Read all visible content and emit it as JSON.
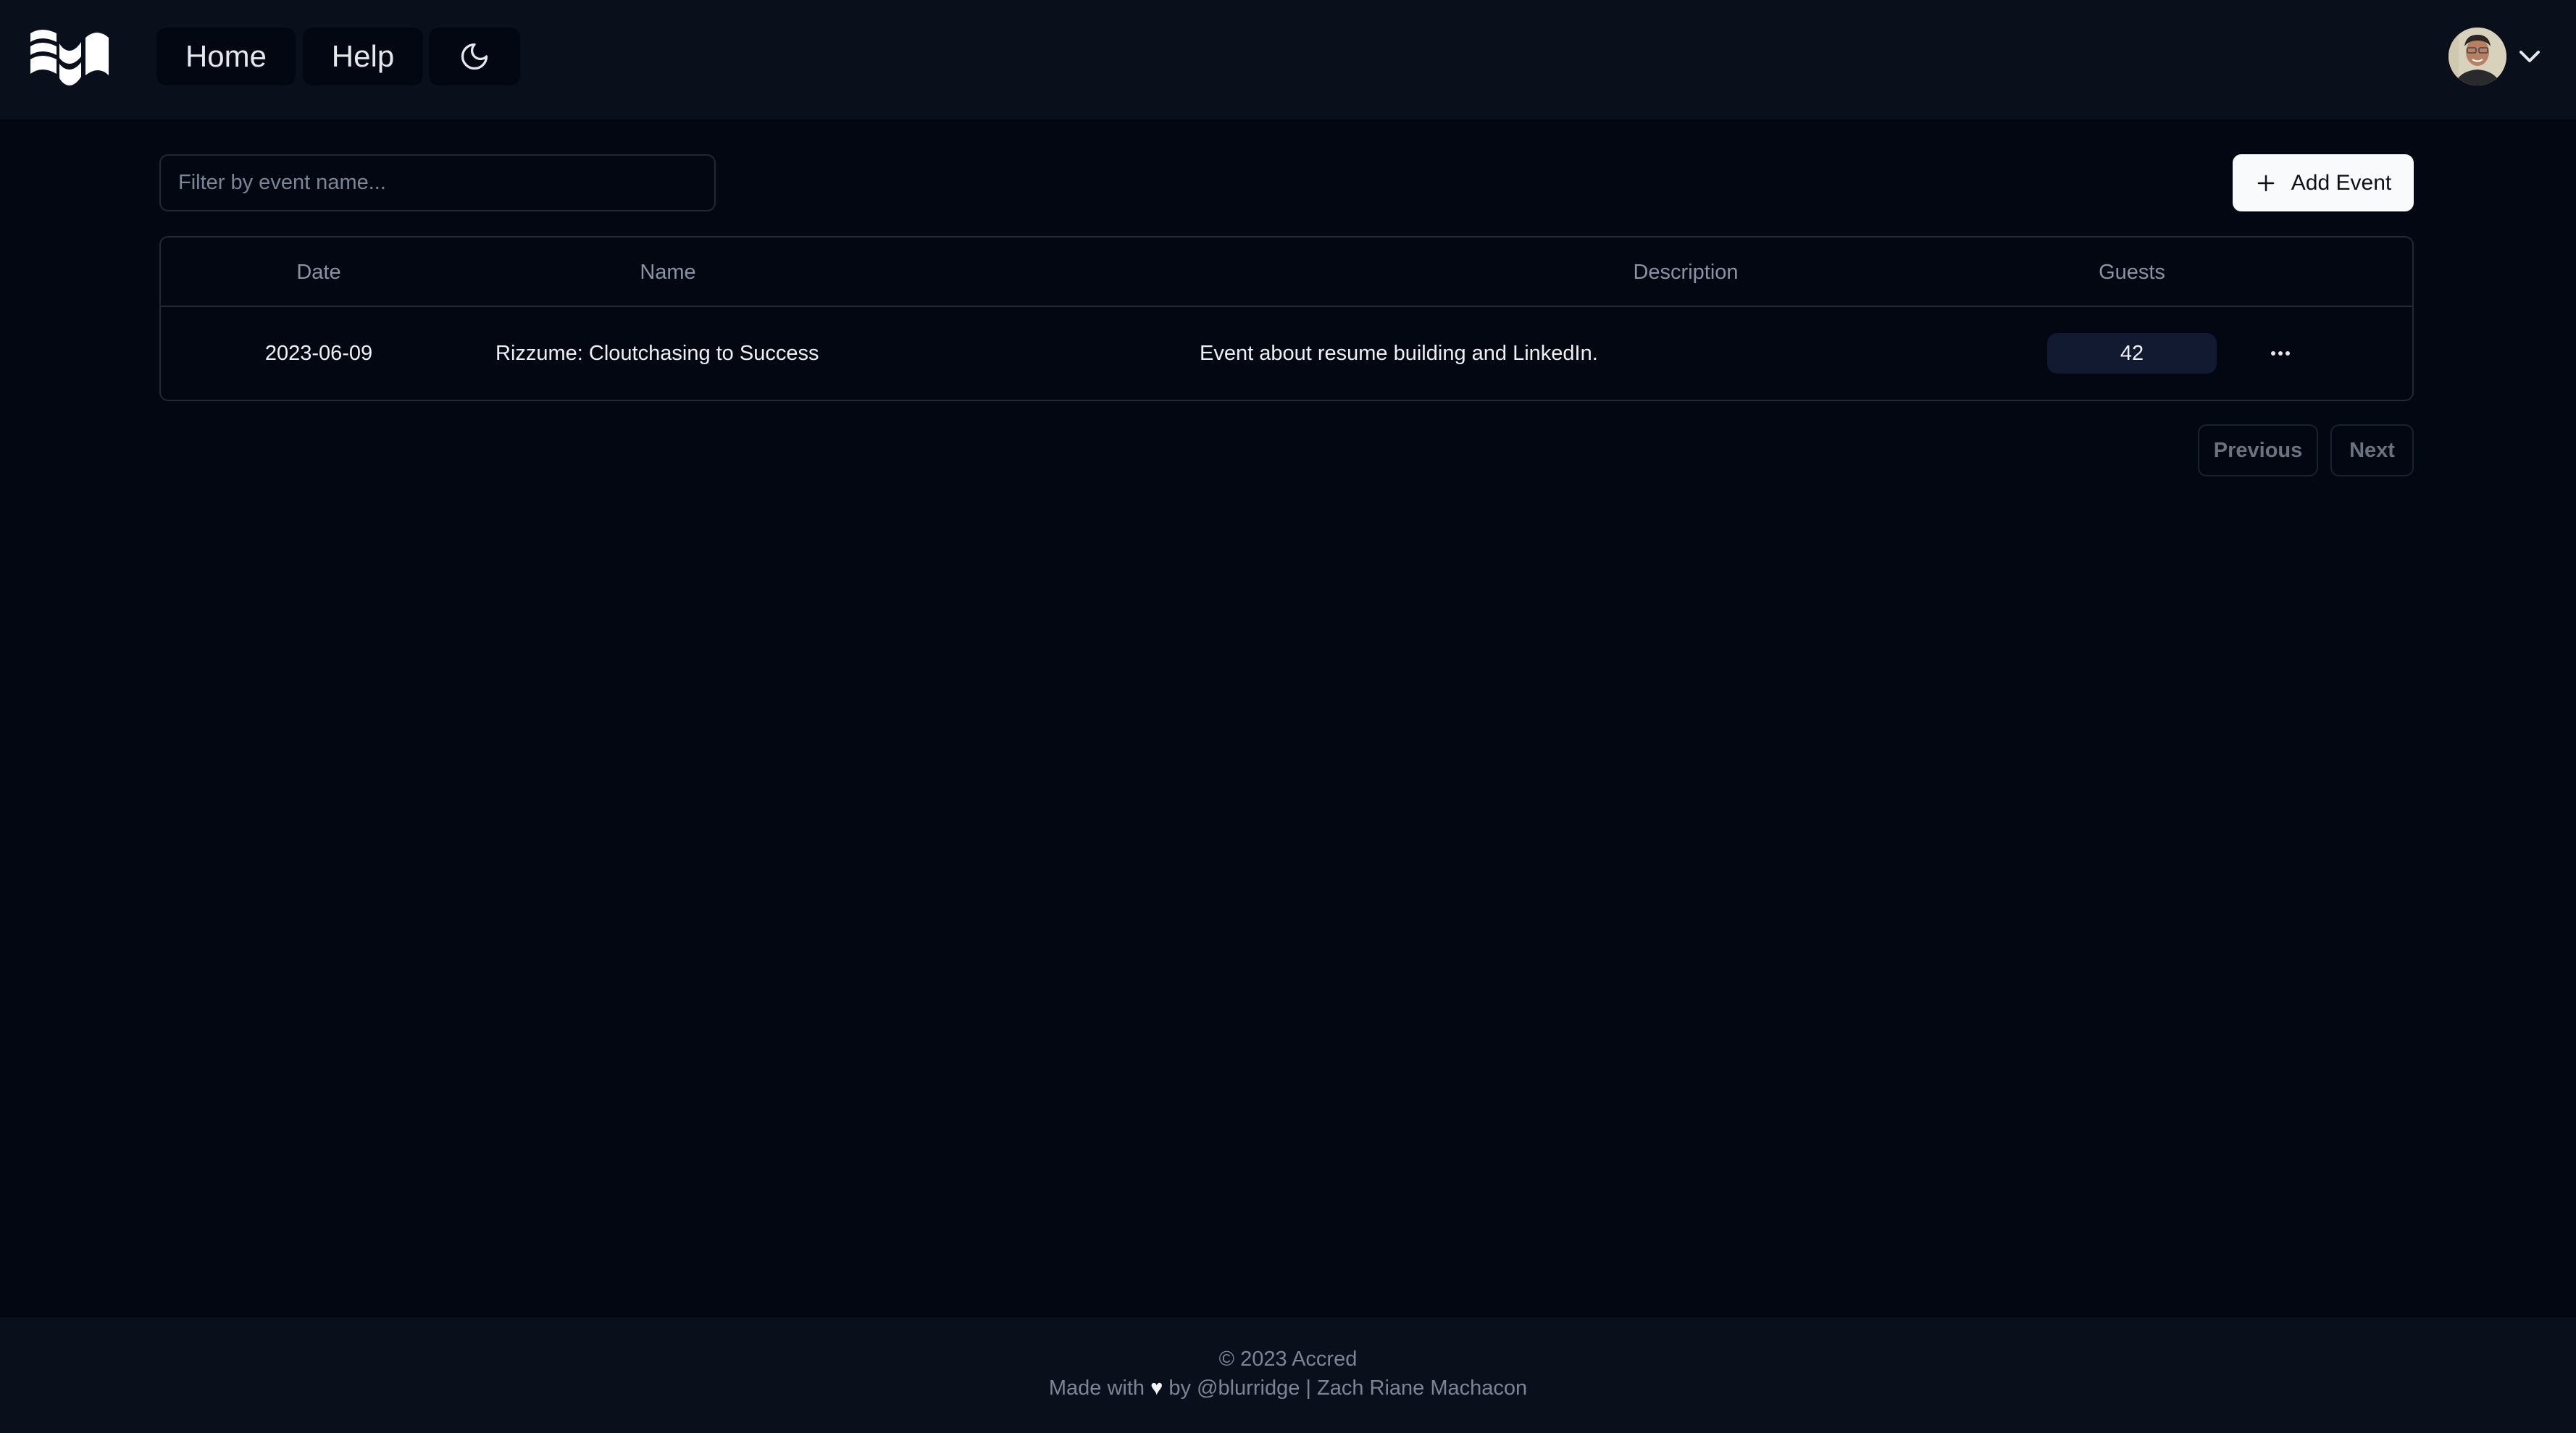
{
  "nav": {
    "home_label": "Home",
    "help_label": "Help",
    "theme_icon": "moon-icon",
    "user_menu_icon": "chevron-down-icon"
  },
  "toolbar": {
    "filter_placeholder": "Filter by event name...",
    "filter_value": "",
    "add_event_label": "Add Event",
    "add_event_icon": "plus-icon"
  },
  "table": {
    "columns": [
      "Date",
      "Name",
      "Description",
      "Guests"
    ],
    "rows": [
      {
        "date": "2023-06-09",
        "name": "Rizzume: Cloutchasing to Success",
        "description": "Event about resume building and LinkedIn.",
        "guests": "42",
        "actions_icon": "more-horizontal-icon"
      }
    ]
  },
  "pagination": {
    "previous_label": "Previous",
    "next_label": "Next"
  },
  "footer": {
    "copyright": "© 2023 Accred",
    "made_with": "Made with",
    "heart": "♥",
    "by_text": "by @blurridge | Zach Riane Machacon"
  },
  "colors": {
    "page_bg": "#030712",
    "header_bg": "#0a0f1c",
    "border": "#1f2937",
    "primary_button_bg": "#f8fafc",
    "badge_bg": "#111a30",
    "muted_text": "#8a93a6"
  }
}
